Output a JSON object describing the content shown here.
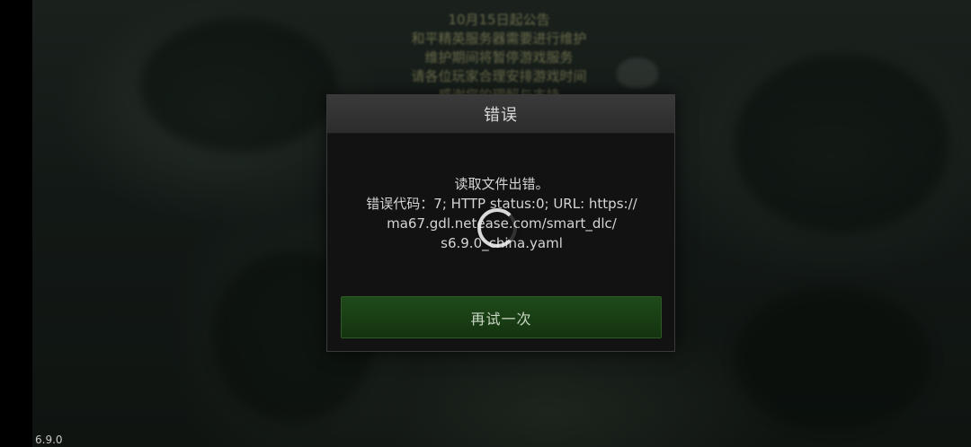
{
  "announcement": {
    "lines": [
      "10月15日起公告",
      "和平精英服务器需要进行维护",
      "维护期间将暂停游戏服务",
      "请各位玩家合理安排游戏时间",
      "感谢您的理解与支持"
    ]
  },
  "dialog": {
    "title": "错误",
    "message_lines": [
      "读取文件出错。",
      "错误代码：7; HTTP status:0; URL: https://",
      "ma67.gdl.netease.com/smart_dlc/",
      "s6.9.0_china.yaml"
    ],
    "retry_label": "再试一次"
  },
  "version": "6.9.0",
  "colors": {
    "dialog_background": "#121212",
    "header_background": "#333333",
    "retry_button": "#1b4016",
    "text": "#d5d5d5"
  },
  "icons": {
    "loading": "loading-spinner-icon"
  }
}
